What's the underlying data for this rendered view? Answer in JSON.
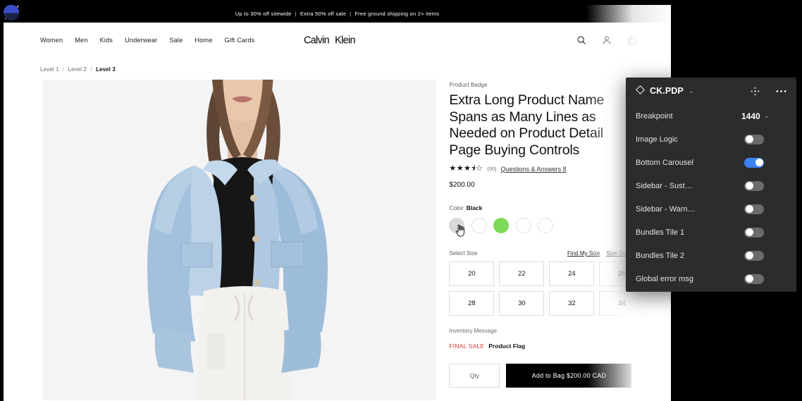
{
  "promo": {
    "items": [
      "Up to 30% off sitewide",
      "Extra 50% off sale",
      "Free ground shipping on 2+ items"
    ]
  },
  "header": {
    "nav": [
      "Women",
      "Men",
      "Kids",
      "Underwear",
      "Sale",
      "Home",
      "Gift Cards"
    ],
    "brand": "Calvin Klein",
    "icons": [
      "search-icon",
      "account-icon",
      "bag-icon"
    ]
  },
  "breadcrumb": {
    "items": [
      "Level 1",
      "Level 2",
      "Level 3"
    ],
    "separator": "/"
  },
  "product": {
    "badge": "Product Badge",
    "title": "Extra Long Product Name Spans as Many Lines as Needed on Product Detail Page Buying Controls",
    "stars": "★★★⯨☆",
    "rating_value": 3.5,
    "review_count": "(00)",
    "qa_link": "Questions & Answers 8",
    "price": "$200.00",
    "color_label": "Color",
    "color_value": "Black",
    "swatches": [
      {
        "type": "twotone",
        "selected": true,
        "slash": false
      },
      {
        "type": "grey",
        "selected": false,
        "slash": false,
        "hover": true
      },
      {
        "type": "white",
        "selected": false,
        "slash": false
      },
      {
        "type": "green",
        "selected": false,
        "slash": false
      },
      {
        "type": "twotone",
        "selected": false,
        "slash": true
      },
      {
        "type": "twotone",
        "selected": false,
        "slash": true
      },
      {
        "type": "empty",
        "selected": false,
        "slash": false
      },
      {
        "type": "twotone",
        "selected": false,
        "slash": false
      },
      {
        "type": "empty",
        "selected": false,
        "slash": false
      },
      {
        "type": "twotone",
        "selected": false,
        "slash": false
      },
      {
        "type": "twotone",
        "selected": false,
        "slash": false
      },
      {
        "type": "twotone",
        "selected": false,
        "slash": true
      },
      {
        "type": "twotone",
        "selected": false,
        "slash": false
      },
      {
        "type": "twotone",
        "selected": false,
        "slash": false
      },
      {
        "type": "twotone",
        "selected": false,
        "slash": false
      },
      {
        "type": "twotone",
        "selected": false,
        "slash": false
      }
    ],
    "size_label": "Select Size",
    "find_my_size": "Find My Size",
    "size_guide": "Size Guide",
    "sizes": [
      "20",
      "22",
      "24",
      "26",
      "28",
      "30",
      "32",
      "34"
    ],
    "inventory_message": "Inventory Message",
    "final_sale": "FINAL SALE",
    "product_flag": "Product Flag",
    "qty_label": "Qty",
    "add_to_bag": "Add to Bag  $200.00 CAD"
  },
  "panel": {
    "title": "CK.PDP",
    "title_caret": "⌄",
    "move_icon": "move-icon",
    "more_icon": "more-options-icon",
    "rows": [
      {
        "label": "Breakpoint",
        "control": "value",
        "value": "1440",
        "caret": "⌄"
      },
      {
        "label": "Image Logic",
        "control": "toggle",
        "on": false
      },
      {
        "label": "Bottom Carousel",
        "control": "toggle",
        "on": true
      },
      {
        "label": "Sidebar - Sust…",
        "control": "toggle",
        "on": false
      },
      {
        "label": "Sidebar - Warn…",
        "control": "toggle",
        "on": false
      },
      {
        "label": "Bundles Tile 1",
        "control": "toggle",
        "on": false
      },
      {
        "label": "Bundles Tile 2",
        "control": "toggle",
        "on": false
      },
      {
        "label": "Global error msg",
        "control": "toggle",
        "on": false
      }
    ]
  },
  "colors": {
    "accent_blue": "#3b82f6",
    "panel_bg": "#2c2c2c",
    "final_sale_red": "#e03b3b",
    "swatch_blue": "#3b4cc8",
    "swatch_navy": "#1b2347",
    "swatch_green": "#7ed957"
  }
}
